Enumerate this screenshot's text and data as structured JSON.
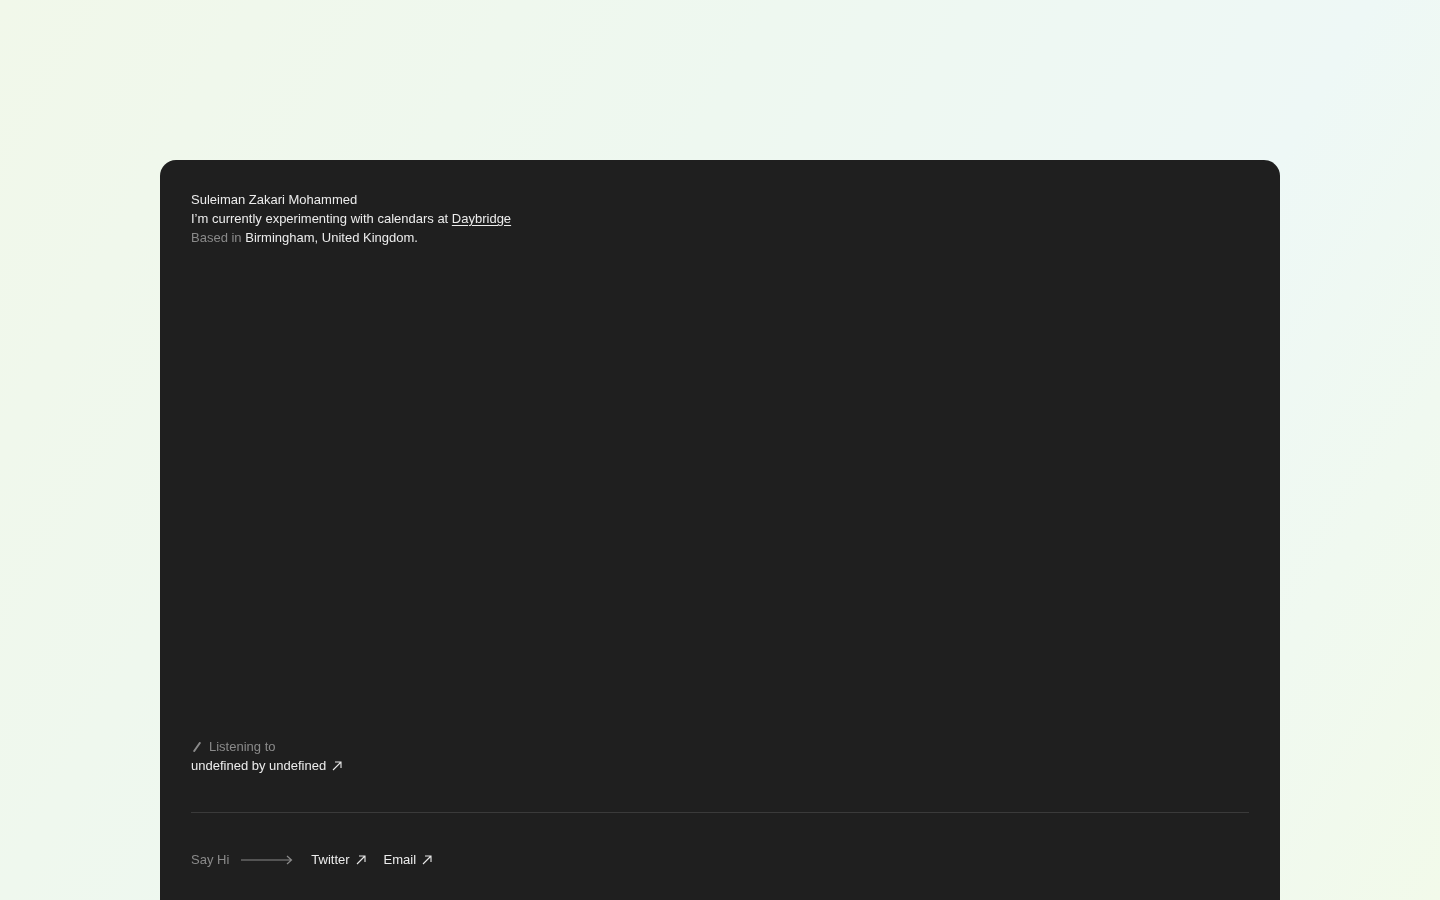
{
  "profile": {
    "name": "Suleiman Zakari Mohammed",
    "intro": "I’m currently experimenting with calendars at",
    "company_link": "Daybridge",
    "location_label": "Based in",
    "location": "Birmingham, United Kingdom."
  },
  "now_playing": {
    "label": "Listening to",
    "track": "undefined by undefined"
  },
  "footer": {
    "prompt": "Say Hi",
    "links": [
      {
        "label": "Twitter"
      },
      {
        "label": "Email"
      }
    ]
  }
}
